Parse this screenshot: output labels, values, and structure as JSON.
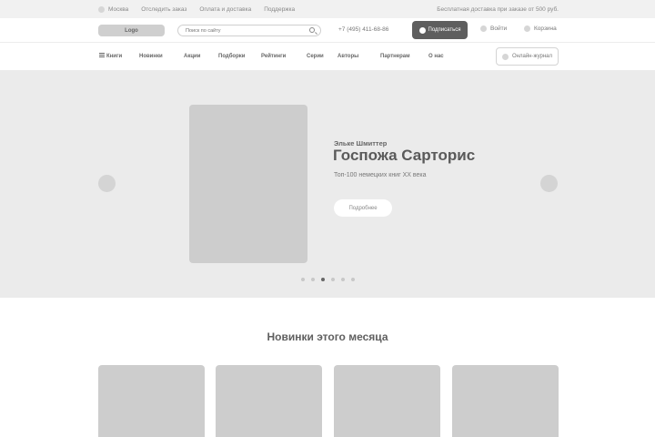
{
  "topbar": {
    "city": "Москва",
    "links": [
      "Отследить заказ",
      "Оплата и доставка",
      "Поддержка"
    ],
    "shipping": "Бесплатная доставка при заказе от 500 руб."
  },
  "header": {
    "logo": "Logo",
    "search_placeholder": "Поиск по сайту",
    "phone": "+7 (495) 411-68-86",
    "subscribe": "Подписаться",
    "login": "Войти",
    "cart": "Корзина"
  },
  "nav": {
    "items": [
      "Книги",
      "Новинки",
      "Акции",
      "Подборки",
      "Рейтинги",
      "Серии",
      "Авторы",
      "Партнерам",
      "О нас"
    ],
    "journal": "Онлайн-журнал"
  },
  "hero": {
    "author": "Эльке Шмиттер",
    "title": "Госпожа Сарторис",
    "subtitle": "Топ-100 немецких книг XX века",
    "more": "Подробнее",
    "slides_total": 6,
    "slide_active": 3
  },
  "new_section": {
    "title": "Новинки этого месяца"
  }
}
